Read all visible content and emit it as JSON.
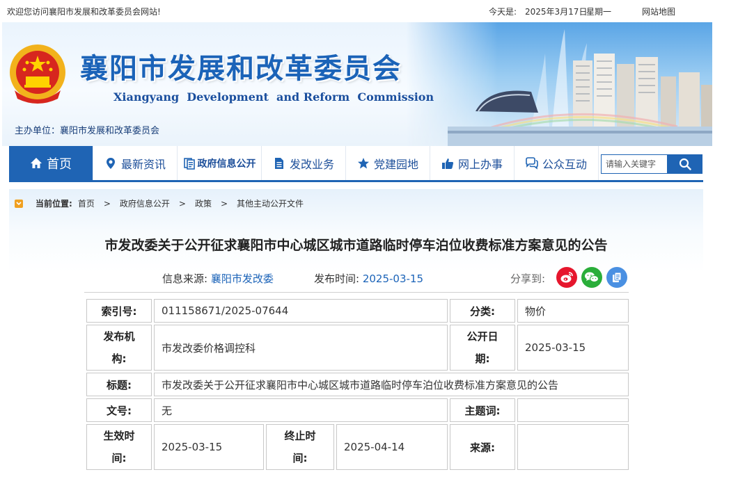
{
  "topbar": {
    "welcome": "欢迎您访问襄阳市发展和改革委员会网站!",
    "date_label": "今天是:",
    "date_value": "2025年3月17日",
    "weekday": "星期一",
    "sitemap": "网站地图"
  },
  "banner": {
    "title_cn": "襄阳市发展和改革委员会",
    "title_en": "Xiangyang  Development  and Reform  Commission",
    "sponsor": "主办单位：襄阳市发展和改革委员会"
  },
  "nav": {
    "items": [
      {
        "label": "首页",
        "icon": "home-icon"
      },
      {
        "label": "最新资讯",
        "icon": "location-pin-icon"
      },
      {
        "label": "政府信息公开",
        "icon": "info-disclosure-icon"
      },
      {
        "label": "发改业务",
        "icon": "document-icon"
      },
      {
        "label": "党建园地",
        "icon": "star-icon"
      },
      {
        "label": "网上办事",
        "icon": "thumbs-up-icon"
      },
      {
        "label": "公众互动",
        "icon": "chat-bubbles-icon"
      }
    ],
    "search_placeholder": "请输入关键字"
  },
  "breadcrumb": {
    "label": "当前位置:",
    "items": [
      "首页",
      "政府信息公开",
      "政策",
      "其他主动公开文件"
    ],
    "separator": ">"
  },
  "article": {
    "title": "市发改委关于公开征求襄阳市中心城区城市道路临时停车泊位收费标准方案意见的公告",
    "source_label": "信息来源:",
    "source_value": "襄阳市发改委",
    "date_label": "发布时间:",
    "date_value": "2025-03-15",
    "share_label": "分享到:"
  },
  "info_table": {
    "index_label": "索引号:",
    "index_value": "011158671/2025-07644",
    "category_label": "分类:",
    "category_value": "物价",
    "org_label_1": "发布机",
    "org_label_2": "构:",
    "org_value": "市发改委价格调控科",
    "pubdate_label_1": "公开日",
    "pubdate_label_2": "期:",
    "pubdate_value": "2025-03-15",
    "title_label": "标题:",
    "title_value": "市发改委关于公开征求襄阳市中心城区城市道路临时停车泊位收费标准方案意见的公告",
    "docno_label": "文号:",
    "docno_value": "无",
    "keyword_label": "主题词:",
    "keyword_value": "",
    "effective_label_1": "生效时",
    "effective_label_2": "间:",
    "effective_value": "2025-03-15",
    "expire_label_1": "终止时",
    "expire_label_2": "间:",
    "expire_value": "2025-04-14",
    "origin_label": "来源:",
    "origin_value": ""
  },
  "colors": {
    "brand_blue": "#1f64b4",
    "link_blue": "#1b63b8",
    "weibo_red": "#e6162d",
    "wechat_green": "#2aae3a",
    "copy_blue": "#4a90e2"
  }
}
